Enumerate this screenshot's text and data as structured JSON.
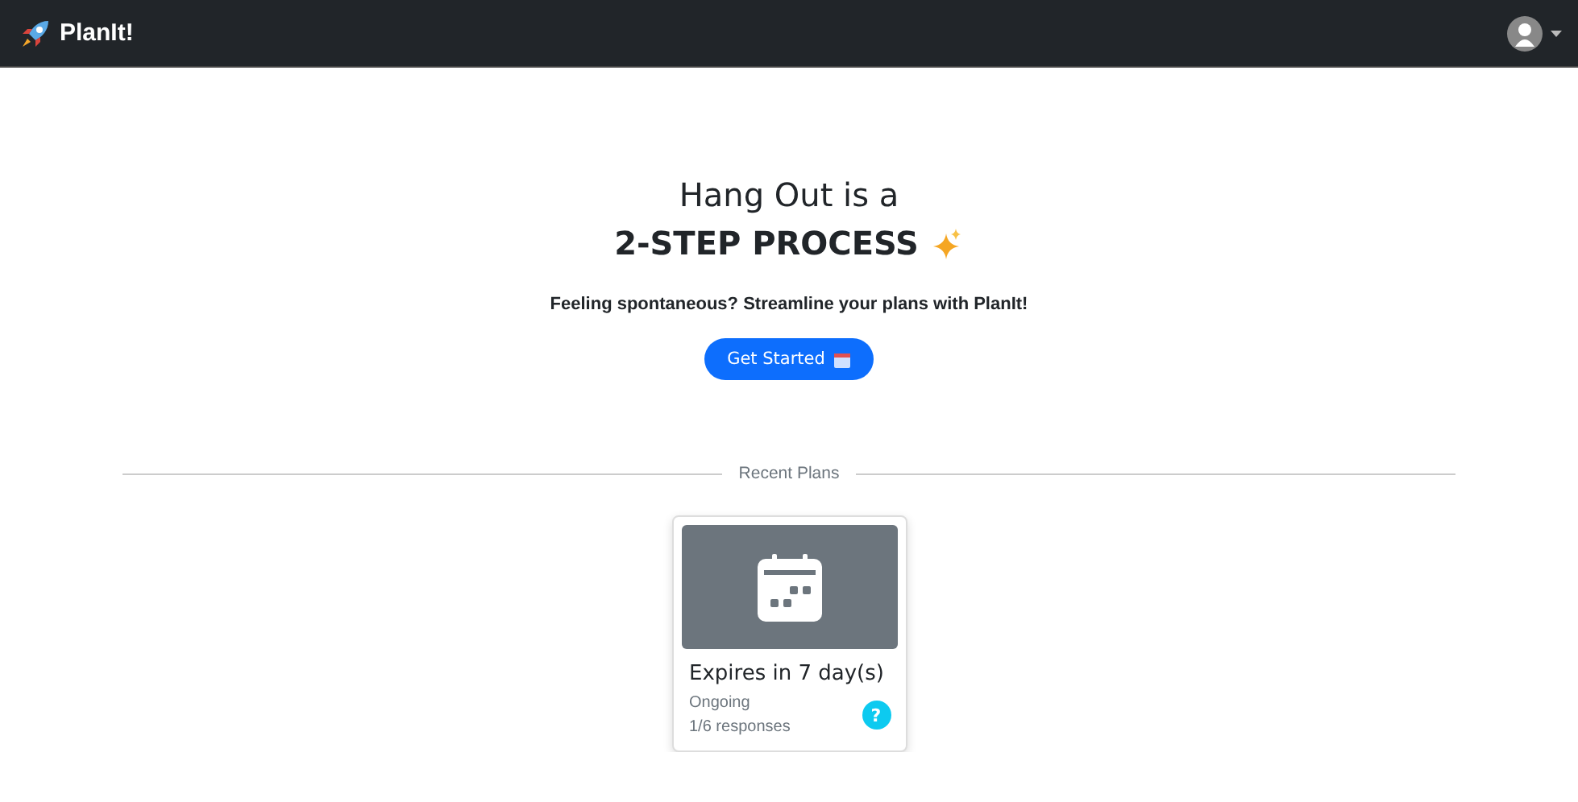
{
  "navbar": {
    "brand": "PlanIt!"
  },
  "hero": {
    "line_1": "Hang Out is a",
    "line_2": "2-STEP PROCESS",
    "subtitle": "Feeling spontaneous? Streamline your plans with PlanIt!",
    "button": "Get Started"
  },
  "recent": {
    "heading": "Recent Plans",
    "plans": [
      {
        "title": "Expires in 7 day(s)",
        "status": "Ongoing",
        "responses": "1/6 responses",
        "badge": "?"
      }
    ]
  }
}
